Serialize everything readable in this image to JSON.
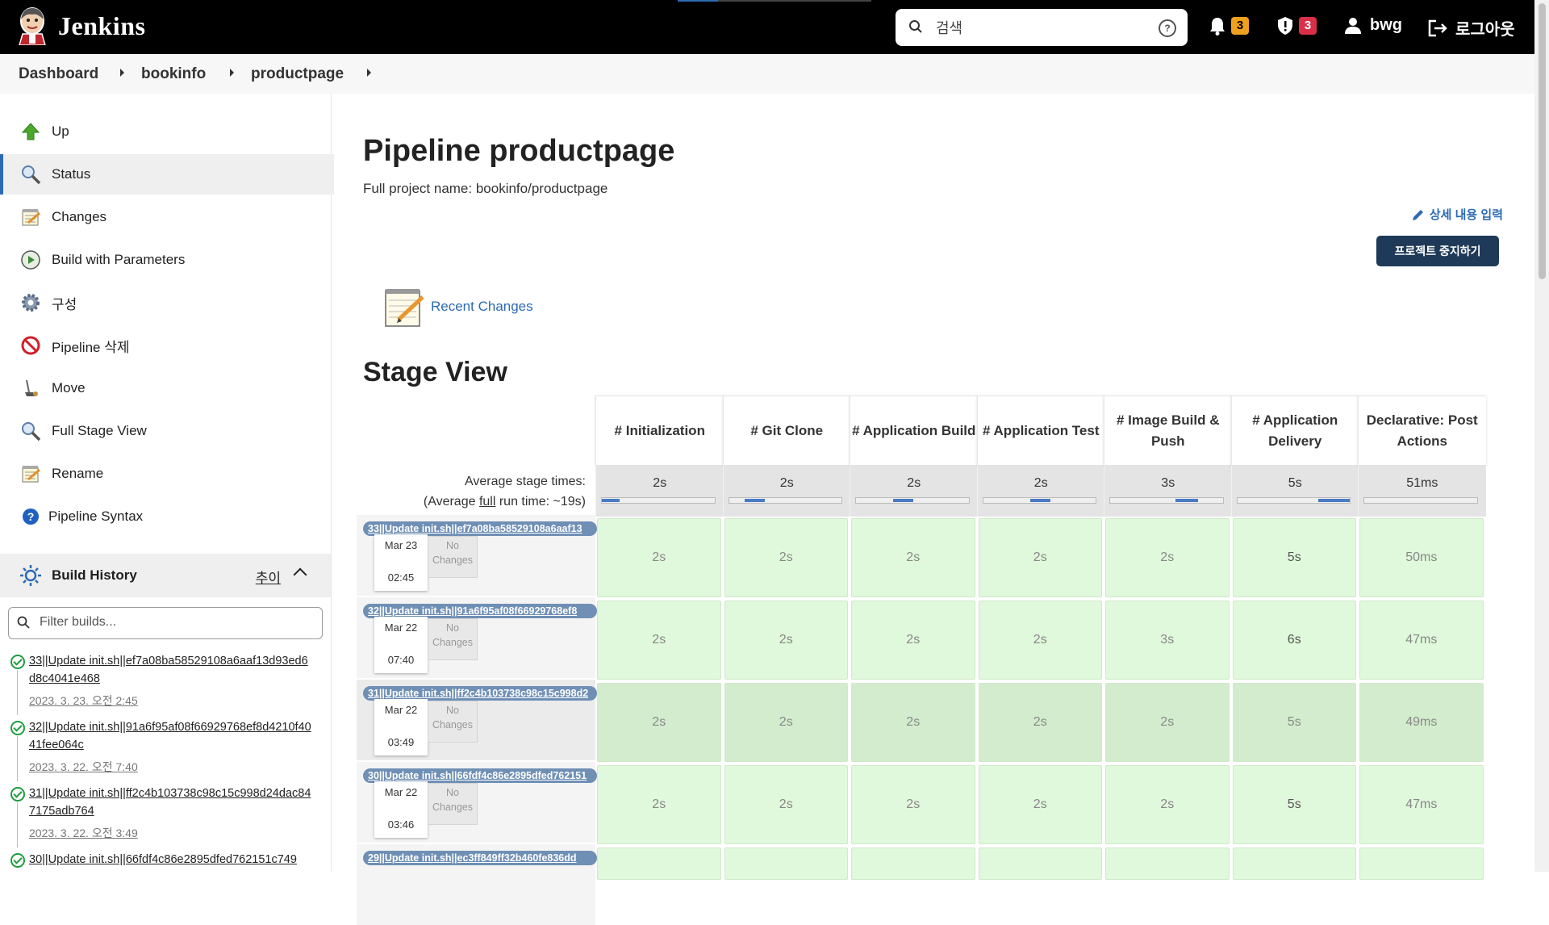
{
  "header": {
    "brand": "Jenkins",
    "search_placeholder": "검색",
    "notifications_count": "3",
    "security_count": "3",
    "username": "bwg",
    "logout": "로그아웃"
  },
  "breadcrumbs": [
    "Dashboard",
    "bookinfo",
    "productpage"
  ],
  "sidebar": {
    "tasks": [
      {
        "label": "Up",
        "icon": "up-arrow-icon"
      },
      {
        "label": "Status",
        "icon": "magnifier-icon"
      },
      {
        "label": "Changes",
        "icon": "notepad-icon"
      },
      {
        "label": "Build with Parameters",
        "icon": "clock-play-icon"
      },
      {
        "label": "구성",
        "icon": "gear-icon"
      },
      {
        "label": "Pipeline 삭제",
        "icon": "no-entry-icon"
      },
      {
        "label": "Move",
        "icon": "move-icon"
      },
      {
        "label": "Full Stage View",
        "icon": "magnifier-icon"
      },
      {
        "label": "Rename",
        "icon": "notepad-icon"
      },
      {
        "label": "Pipeline Syntax",
        "icon": "help-icon"
      }
    ],
    "build_history": {
      "title": "Build History",
      "trend": "추이",
      "filter_placeholder": "Filter builds...",
      "builds": [
        {
          "name": "33||Update init.sh||ef7a08ba58529108a6aaf13d93ed6d8c4041e468",
          "date": "2023. 3. 23. 오전 2:45"
        },
        {
          "name": "32||Update init.sh||91a6f95af08f66929768ef8d4210f4041fee064c",
          "date": "2023. 3. 22. 오전 7:40"
        },
        {
          "name": "31||Update init.sh||ff2c4b103738c98c15c998d24dac847175adb764",
          "date": "2023. 3. 22. 오전 3:49"
        },
        {
          "name": "30||Update init.sh||66fdf4c86e2895dfed762151c749",
          "date": ""
        }
      ]
    }
  },
  "main": {
    "title": "Pipeline productpage",
    "full_project_name": "Full project name: bookinfo/productpage",
    "edit_description": "상세 내용 입력",
    "disable_project": "프로젝트 중지하기",
    "recent_changes": "Recent Changes",
    "stage_view_title": "Stage View",
    "average_stage_times": "Average stage times:",
    "average_full_run_pre": "(Average ",
    "average_full_run_link": "full",
    "average_full_run_post": " run time: ~19s)"
  },
  "stage_view": {
    "stages": [
      "# Initialization",
      "# Git Clone",
      "# Application Build",
      "# Application Test",
      "# Image Build & Push",
      "# Application Delivery",
      "Declarative: Post Actions"
    ],
    "average_times": [
      "2s",
      "2s",
      "2s",
      "2s",
      "3s",
      "5s",
      "51ms"
    ],
    "runs": [
      {
        "label": "33||Update init.sh||ef7a08ba58529108a6aaf13",
        "date": "Mar 23",
        "time": "02:45",
        "changes": "No Changes",
        "times": [
          "2s",
          "2s",
          "2s",
          "2s",
          "2s",
          "5s",
          "50ms"
        ]
      },
      {
        "label": "32||Update init.sh||91a6f95af08f66929768ef8",
        "date": "Mar 22",
        "time": "07:40",
        "changes": "No Changes",
        "times": [
          "2s",
          "2s",
          "2s",
          "2s",
          "3s",
          "6s",
          "47ms"
        ]
      },
      {
        "label": "31||Update init.sh||ff2c4b103738c98c15c998d2",
        "date": "Mar 22",
        "time": "03:49",
        "changes": "No Changes",
        "times": [
          "2s",
          "2s",
          "2s",
          "2s",
          "2s",
          "5s",
          "49ms"
        ]
      },
      {
        "label": "30||Update init.sh||66fdf4c86e2895dfed762151",
        "date": "Mar 22",
        "time": "03:46",
        "changes": "No Changes",
        "times": [
          "2s",
          "2s",
          "2s",
          "2s",
          "2s",
          "5s",
          "47ms"
        ]
      },
      {
        "label": "29||Update init.sh||ec3ff849ff32b460fe836dd",
        "date": "",
        "time": "",
        "changes": "",
        "times": [
          "",
          "",
          "",
          "",
          "",
          "",
          ""
        ]
      }
    ]
  },
  "colors": {
    "header_bg": "#000000",
    "accent": "#2d6ab4",
    "success_cell": "#e0f8db",
    "primary_button": "#1e3a58"
  }
}
